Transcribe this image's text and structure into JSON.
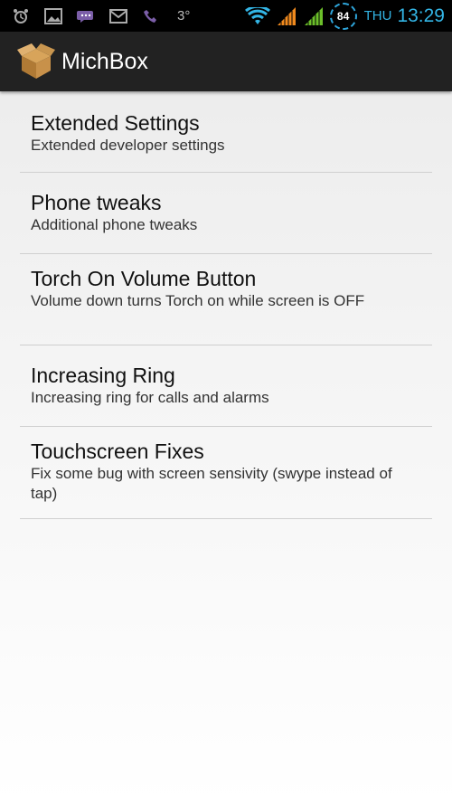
{
  "status_bar": {
    "temperature": "3°",
    "battery_level": "84",
    "day": "THU",
    "time": "13:29",
    "icons": [
      "alarm-icon",
      "gallery-icon",
      "viber-chat-icon",
      "mail-icon",
      "viber-phone-icon",
      "wifi-icon",
      "signal-orange-icon",
      "signal-green-icon"
    ]
  },
  "action_bar": {
    "title": "MichBox",
    "app_icon": "open-box-icon"
  },
  "preferences": [
    {
      "title": "Extended Settings",
      "summary": "Extended developer settings"
    },
    {
      "title": "Phone tweaks",
      "summary": "Additional phone tweaks"
    },
    {
      "title": "Torch On Volume Button",
      "summary": "Volume down turns Torch on while screen is OFF"
    },
    {
      "title": "Increasing Ring",
      "summary": "Increasing ring for calls and alarms"
    },
    {
      "title": "Touchscreen Fixes",
      "summary": "Fix some bug with screen sensivity (swype instead of tap)"
    }
  ],
  "colors": {
    "accent": "#33b5e5",
    "action_bar": "#222222",
    "status_bar": "#000000",
    "signal_orange": "#f08a1e",
    "signal_green": "#6cbf2a"
  }
}
